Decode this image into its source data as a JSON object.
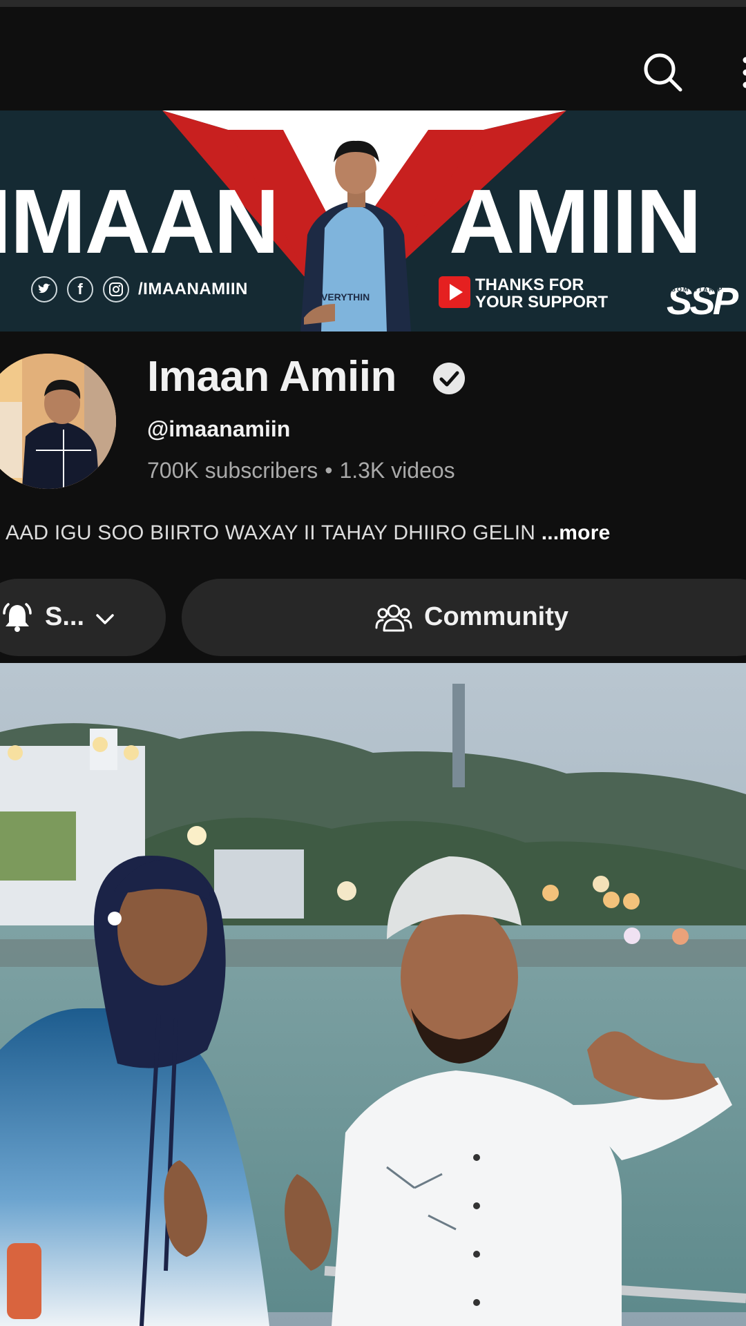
{
  "app_bar": {
    "search_icon": "search-icon",
    "more_icon": "more-vertical-icon"
  },
  "banner": {
    "title_left": "IMAAN",
    "title_right": "AMIIN",
    "social_handle": "/IMAANAMIIN",
    "social_icons": [
      "twitter-icon",
      "facebook-icon",
      "instagram-icon"
    ],
    "thanks_line1": "THANKS FOR",
    "thanks_line2": "YOUR SUPPORT",
    "ssp_logo": "SSP",
    "ssp_small": "SOM STAR P",
    "shirt_text": "VERYTHIN",
    "colors": {
      "background": "#152a33",
      "accent_red": "#c8201f",
      "white_triangle": "#ffffff"
    }
  },
  "channel": {
    "name": "Imaan Amiin",
    "verified_icon": "verified-check-icon",
    "handle": "@imaanamiin",
    "subscribers": "700K subscribers",
    "separator": "•",
    "videos": "1.3K videos",
    "description": "AAD IGU SOO BIIRTO WAXAY II TAHAY DHIIRO GELIN",
    "more_label": "...more"
  },
  "actions": {
    "subscribed_label": "S...",
    "bell_icon": "bell-ringing-icon",
    "chevron_icon": "chevron-down-icon",
    "community_label": "Community",
    "community_icon": "people-icon"
  },
  "theme": {
    "background": "#0f0f0f",
    "button_bg": "#272727",
    "text_primary": "#f1f1f1",
    "text_secondary": "#aaaaaa"
  }
}
